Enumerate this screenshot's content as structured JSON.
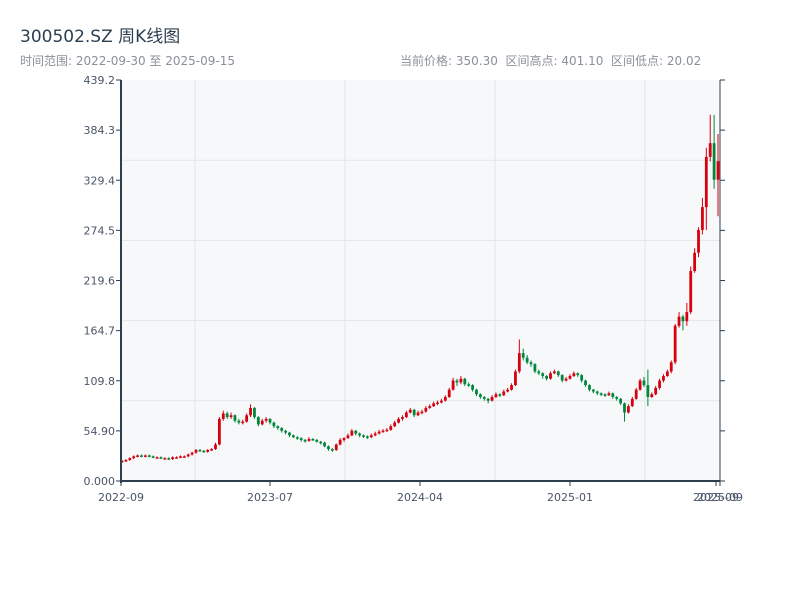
{
  "header": {
    "title": "300502.SZ 周K线图",
    "range_label": "时间范围: 2022-09-30 至 2025-09-15",
    "current_price": "当前价格: 350.30",
    "range_high": "区间高点: 401.10",
    "range_low": "区间低点: 20.02"
  },
  "colors": {
    "up": "#d7000f",
    "down": "#00873c",
    "axis": "#2c3e50",
    "plot_bg": "#f7f8fa",
    "grid": "#e2e5ea"
  },
  "chart_data": {
    "type": "candlestick",
    "title": "300502.SZ 周K线图",
    "period": "weekly",
    "date_range": [
      "2022-09-30",
      "2025-09-15"
    ],
    "ylim": [
      0,
      439.2
    ],
    "yticks": [
      "0.000",
      "54.90",
      "109.8",
      "164.7",
      "219.6",
      "274.5",
      "329.4",
      "384.3",
      "439.2"
    ],
    "xticks": [
      "2022-09",
      "2023-07",
      "2024-04",
      "2025-01",
      "2025-09",
      "2025-09"
    ],
    "grid": true,
    "ohlc_fields": [
      "open",
      "high",
      "low",
      "close"
    ],
    "candles": [
      [
        21,
        23,
        20.02,
        22
      ],
      [
        22,
        24,
        21,
        23
      ],
      [
        23,
        26,
        22,
        25
      ],
      [
        25,
        28,
        24,
        27
      ],
      [
        27,
        29,
        26,
        28
      ],
      [
        28,
        29,
        26,
        27
      ],
      [
        27,
        29,
        26,
        28
      ],
      [
        28,
        29,
        26,
        27
      ],
      [
        27,
        28,
        25,
        26
      ],
      [
        26,
        27,
        25,
        26
      ],
      [
        26,
        27,
        24,
        25
      ],
      [
        25,
        26,
        24,
        25
      ],
      [
        25,
        26,
        23,
        24
      ],
      [
        24,
        27,
        23,
        26
      ],
      [
        26,
        27,
        25,
        26
      ],
      [
        26,
        28,
        25,
        27
      ],
      [
        27,
        28,
        26,
        27
      ],
      [
        27,
        30,
        26,
        29
      ],
      [
        29,
        32,
        28,
        31
      ],
      [
        31,
        35,
        30,
        34
      ],
      [
        34,
        35,
        32,
        33
      ],
      [
        33,
        34,
        31,
        32
      ],
      [
        32,
        35,
        31,
        34
      ],
      [
        34,
        36,
        33,
        35
      ],
      [
        35,
        42,
        34,
        40
      ],
      [
        40,
        70,
        39,
        68
      ],
      [
        68,
        77,
        66,
        74
      ],
      [
        74,
        76,
        68,
        70
      ],
      [
        70,
        75,
        68,
        72
      ],
      [
        72,
        73,
        64,
        66
      ],
      [
        66,
        68,
        62,
        64
      ],
      [
        64,
        67,
        62,
        65
      ],
      [
        65,
        74,
        64,
        72
      ],
      [
        72,
        84,
        70,
        80
      ],
      [
        80,
        81,
        68,
        70
      ],
      [
        70,
        71,
        60,
        62
      ],
      [
        62,
        68,
        61,
        66
      ],
      [
        66,
        70,
        64,
        68
      ],
      [
        68,
        69,
        62,
        64
      ],
      [
        64,
        65,
        58,
        60
      ],
      [
        60,
        61,
        56,
        58
      ],
      [
        58,
        59,
        53,
        55
      ],
      [
        55,
        56,
        51,
        53
      ],
      [
        53,
        54,
        48,
        50
      ],
      [
        50,
        51,
        47,
        48
      ],
      [
        48,
        49,
        45,
        47
      ],
      [
        47,
        48,
        43,
        45
      ],
      [
        45,
        46,
        42,
        44
      ],
      [
        44,
        48,
        43,
        46
      ],
      [
        46,
        47,
        44,
        45
      ],
      [
        45,
        46,
        42,
        43
      ],
      [
        43,
        44,
        40,
        42
      ],
      [
        42,
        43,
        37,
        38
      ],
      [
        38,
        39,
        33,
        35
      ],
      [
        35,
        36,
        32,
        34
      ],
      [
        34,
        41,
        33,
        40
      ],
      [
        40,
        47,
        39,
        45
      ],
      [
        45,
        48,
        43,
        47
      ],
      [
        47,
        52,
        46,
        50
      ],
      [
        50,
        57,
        49,
        55
      ],
      [
        55,
        56,
        50,
        52
      ],
      [
        52,
        53,
        48,
        50
      ],
      [
        50,
        51,
        47,
        49
      ],
      [
        49,
        50,
        46,
        48
      ],
      [
        48,
        52,
        47,
        50
      ],
      [
        50,
        54,
        49,
        52
      ],
      [
        52,
        56,
        51,
        54
      ],
      [
        54,
        57,
        53,
        55
      ],
      [
        55,
        58,
        54,
        56
      ],
      [
        56,
        62,
        55,
        60
      ],
      [
        60,
        66,
        59,
        64
      ],
      [
        64,
        70,
        63,
        68
      ],
      [
        68,
        72,
        66,
        70
      ],
      [
        70,
        77,
        69,
        75
      ],
      [
        75,
        80,
        74,
        78
      ],
      [
        78,
        79,
        70,
        72
      ],
      [
        72,
        77,
        71,
        75
      ],
      [
        75,
        78,
        73,
        76
      ],
      [
        76,
        82,
        75,
        80
      ],
      [
        80,
        84,
        79,
        82
      ],
      [
        82,
        87,
        81,
        85
      ],
      [
        85,
        88,
        83,
        86
      ],
      [
        86,
        90,
        85,
        88
      ],
      [
        88,
        94,
        87,
        92
      ],
      [
        92,
        102,
        91,
        100
      ],
      [
        100,
        113,
        99,
        110
      ],
      [
        110,
        112,
        104,
        108
      ],
      [
        108,
        115,
        106,
        112
      ],
      [
        112,
        113,
        104,
        106
      ],
      [
        106,
        108,
        103,
        105
      ],
      [
        105,
        106,
        98,
        100
      ],
      [
        100,
        101,
        93,
        95
      ],
      [
        95,
        96,
        90,
        92
      ],
      [
        92,
        93,
        88,
        90
      ],
      [
        90,
        91,
        85,
        88
      ],
      [
        88,
        94,
        87,
        92
      ],
      [
        92,
        97,
        91,
        95
      ],
      [
        95,
        96,
        92,
        94
      ],
      [
        94,
        100,
        93,
        98
      ],
      [
        98,
        102,
        97,
        100
      ],
      [
        100,
        107,
        99,
        105
      ],
      [
        105,
        122,
        104,
        120
      ],
      [
        120,
        155,
        118,
        140
      ],
      [
        140,
        145,
        132,
        135
      ],
      [
        135,
        138,
        128,
        130
      ],
      [
        130,
        132,
        125,
        128
      ],
      [
        128,
        129,
        118,
        120
      ],
      [
        120,
        122,
        116,
        118
      ],
      [
        118,
        119,
        112,
        115
      ],
      [
        115,
        116,
        110,
        112
      ],
      [
        112,
        120,
        111,
        118
      ],
      [
        118,
        122,
        117,
        120
      ],
      [
        120,
        121,
        114,
        116
      ],
      [
        116,
        117,
        108,
        110
      ],
      [
        110,
        114,
        109,
        112
      ],
      [
        112,
        117,
        111,
        115
      ],
      [
        115,
        120,
        114,
        118
      ],
      [
        118,
        119,
        114,
        116
      ],
      [
        116,
        117,
        108,
        110
      ],
      [
        110,
        111,
        103,
        105
      ],
      [
        105,
        106,
        98,
        100
      ],
      [
        100,
        101,
        96,
        98
      ],
      [
        98,
        99,
        94,
        96
      ],
      [
        96,
        97,
        93,
        95
      ],
      [
        95,
        96,
        92,
        94
      ],
      [
        94,
        98,
        93,
        96
      ],
      [
        96,
        97,
        90,
        92
      ],
      [
        92,
        93,
        88,
        90
      ],
      [
        90,
        91,
        83,
        85
      ],
      [
        85,
        86,
        65,
        75
      ],
      [
        75,
        84,
        74,
        82
      ],
      [
        82,
        92,
        81,
        90
      ],
      [
        90,
        102,
        89,
        100
      ],
      [
        100,
        112,
        99,
        110
      ],
      [
        110,
        114,
        103,
        105
      ],
      [
        105,
        122,
        82,
        92
      ],
      [
        92,
        97,
        91,
        95
      ],
      [
        95,
        104,
        94,
        102
      ],
      [
        102,
        112,
        100,
        110
      ],
      [
        110,
        117,
        108,
        115
      ],
      [
        115,
        122,
        114,
        120
      ],
      [
        120,
        132,
        118,
        130
      ],
      [
        130,
        172,
        128,
        170
      ],
      [
        170,
        185,
        168,
        180
      ],
      [
        180,
        182,
        165,
        175
      ],
      [
        175,
        195,
        170,
        185
      ],
      [
        185,
        235,
        183,
        230
      ],
      [
        230,
        255,
        228,
        250
      ],
      [
        250,
        278,
        245,
        275
      ],
      [
        275,
        310,
        270,
        300
      ],
      [
        300,
        365,
        275,
        355
      ],
      [
        355,
        401.1,
        350,
        370
      ],
      [
        370,
        401,
        320,
        330
      ],
      [
        330,
        380,
        290,
        350.3
      ]
    ]
  }
}
